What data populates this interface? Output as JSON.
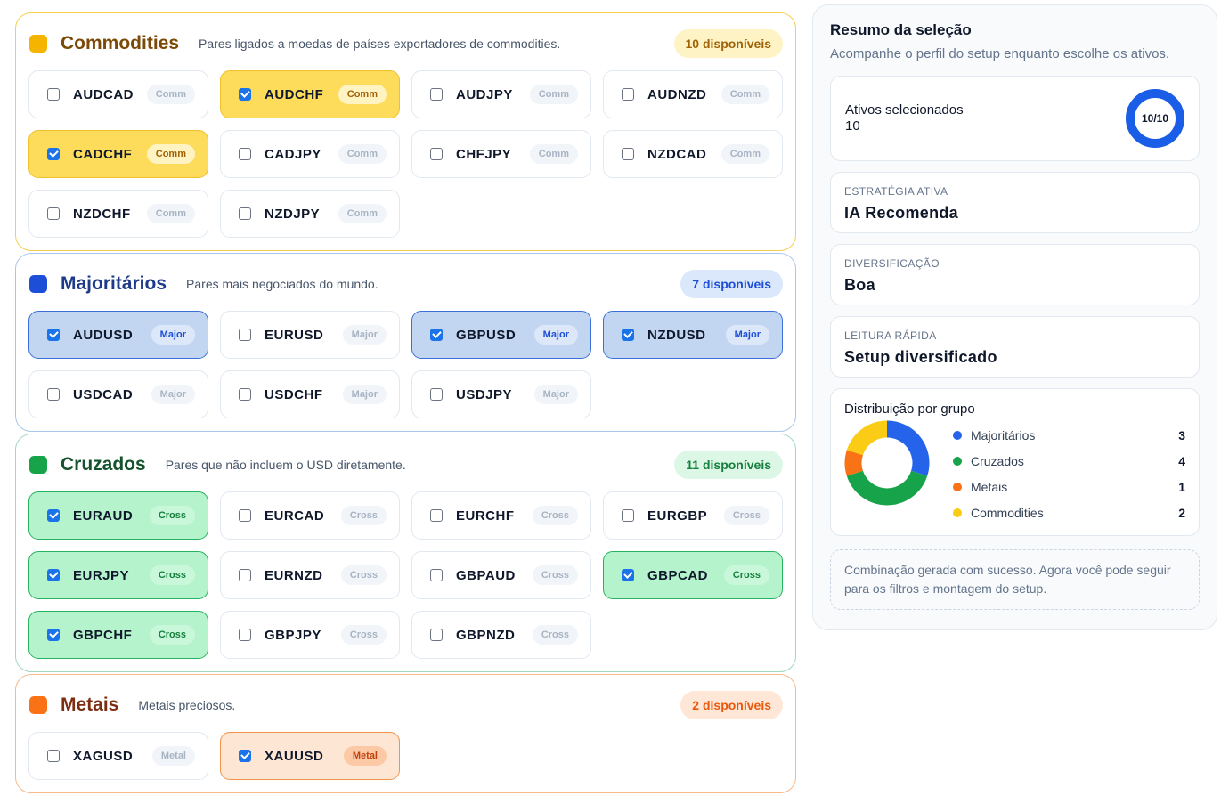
{
  "groups": [
    {
      "key": "comm",
      "title": "Commodities",
      "description": "Pares ligados a moedas de países exportadores de commodities.",
      "count_label": "10 disponíveis",
      "color": "#f5b400",
      "pairs": [
        {
          "symbol": "AUDCAD",
          "tag": "Comm",
          "selected": false
        },
        {
          "symbol": "AUDCHF",
          "tag": "Comm",
          "selected": true
        },
        {
          "symbol": "AUDJPY",
          "tag": "Comm",
          "selected": false
        },
        {
          "symbol": "AUDNZD",
          "tag": "Comm",
          "selected": false
        },
        {
          "symbol": "CADCHF",
          "tag": "Comm",
          "selected": true
        },
        {
          "symbol": "CADJPY",
          "tag": "Comm",
          "selected": false
        },
        {
          "symbol": "CHFJPY",
          "tag": "Comm",
          "selected": false
        },
        {
          "symbol": "NZDCAD",
          "tag": "Comm",
          "selected": false
        },
        {
          "symbol": "NZDCHF",
          "tag": "Comm",
          "selected": false
        },
        {
          "symbol": "NZDJPY",
          "tag": "Comm",
          "selected": false
        }
      ]
    },
    {
      "key": "major",
      "title": "Majoritários",
      "description": "Pares mais negociados do mundo.",
      "count_label": "7 disponíveis",
      "color": "#1d4ed8",
      "pairs": [
        {
          "symbol": "AUDUSD",
          "tag": "Major",
          "selected": true
        },
        {
          "symbol": "EURUSD",
          "tag": "Major",
          "selected": false
        },
        {
          "symbol": "GBPUSD",
          "tag": "Major",
          "selected": true
        },
        {
          "symbol": "NZDUSD",
          "tag": "Major",
          "selected": true
        },
        {
          "symbol": "USDCAD",
          "tag": "Major",
          "selected": false
        },
        {
          "symbol": "USDCHF",
          "tag": "Major",
          "selected": false
        },
        {
          "symbol": "USDJPY",
          "tag": "Major",
          "selected": false
        }
      ]
    },
    {
      "key": "cross",
      "title": "Cruzados",
      "description": "Pares que não incluem o USD diretamente.",
      "count_label": "11 disponíveis",
      "color": "#16a34a",
      "pairs": [
        {
          "symbol": "EURAUD",
          "tag": "Cross",
          "selected": true
        },
        {
          "symbol": "EURCAD",
          "tag": "Cross",
          "selected": false
        },
        {
          "symbol": "EURCHF",
          "tag": "Cross",
          "selected": false
        },
        {
          "symbol": "EURGBP",
          "tag": "Cross",
          "selected": false
        },
        {
          "symbol": "EURJPY",
          "tag": "Cross",
          "selected": true
        },
        {
          "symbol": "EURNZD",
          "tag": "Cross",
          "selected": false
        },
        {
          "symbol": "GBPAUD",
          "tag": "Cross",
          "selected": false
        },
        {
          "symbol": "GBPCAD",
          "tag": "Cross",
          "selected": true
        },
        {
          "symbol": "GBPCHF",
          "tag": "Cross",
          "selected": true
        },
        {
          "symbol": "GBPJPY",
          "tag": "Cross",
          "selected": false
        },
        {
          "symbol": "GBPNZD",
          "tag": "Cross",
          "selected": false
        }
      ]
    },
    {
      "key": "metal",
      "title": "Metais",
      "description": "Metais preciosos.",
      "count_label": "2 disponíveis",
      "color": "#f97316",
      "pairs": [
        {
          "symbol": "XAGUSD",
          "tag": "Metal",
          "selected": false
        },
        {
          "symbol": "XAUUSD",
          "tag": "Metal",
          "selected": true
        }
      ]
    }
  ],
  "summary": {
    "title": "Resumo da seleção",
    "subtitle": "Acompanhe o perfil do setup enquanto escolhe os ativos.",
    "selected_label": "Ativos selecionados",
    "selected_value": "10",
    "selected_ratio": "10/10",
    "strategy_key": "ESTRATÉGIA ATIVA",
    "strategy_value": "IA Recomenda",
    "diversification_key": "DIVERSIFICAÇÃO",
    "diversification_value": "Boa",
    "quick_key": "LEITURA RÁPIDA",
    "quick_value": "Setup diversificado",
    "distribution_title": "Distribuição por grupo",
    "note": "Combinação gerada com sucesso. Agora você pode seguir para os filtros e montagem do setup."
  },
  "chart_data": {
    "type": "pie",
    "style": "donut",
    "categories": [
      "Majoritários",
      "Cruzados",
      "Metais",
      "Commodities"
    ],
    "values": [
      3,
      4,
      1,
      2
    ],
    "colors": [
      "#2563eb",
      "#16a34a",
      "#f97316",
      "#facc15"
    ],
    "legend": "right"
  }
}
